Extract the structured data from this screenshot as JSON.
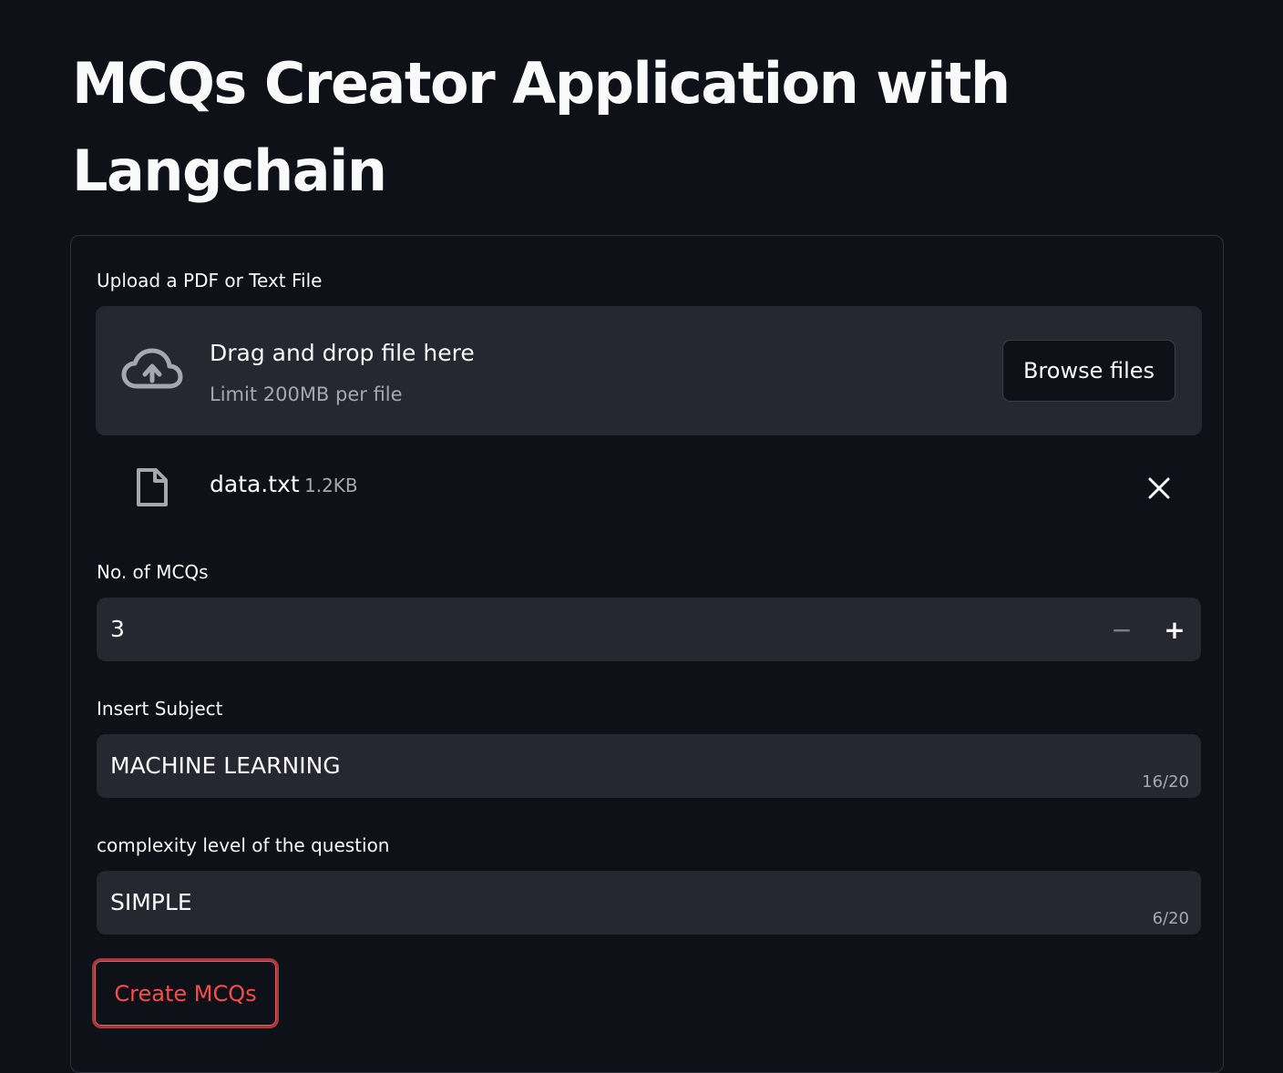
{
  "page": {
    "title": "MCQs Creator Application with Langchain"
  },
  "uploader": {
    "label": "Upload a PDF or Text File",
    "drop_title": "Drag and drop file here",
    "drop_limit": "Limit 200MB per file",
    "browse_label": "Browse files",
    "file": {
      "name": "data.txt",
      "size": "1.2KB"
    }
  },
  "mcq_count": {
    "label": "No. of MCQs",
    "value": "3",
    "minus": "−",
    "plus": "+"
  },
  "subject": {
    "label": "Insert Subject",
    "value": "MACHINE LEARNING",
    "counter": "16/20"
  },
  "complexity": {
    "label": "complexity level of the question",
    "value": "SIMPLE",
    "counter": "6/20"
  },
  "submit": {
    "label": "Create MCQs"
  },
  "icons": {
    "upload": "cloud-upload-icon",
    "file": "file-icon",
    "remove": "close-icon"
  },
  "colors": {
    "background": "#0e1117",
    "field": "#262730",
    "accent": "#ff4b4b"
  }
}
